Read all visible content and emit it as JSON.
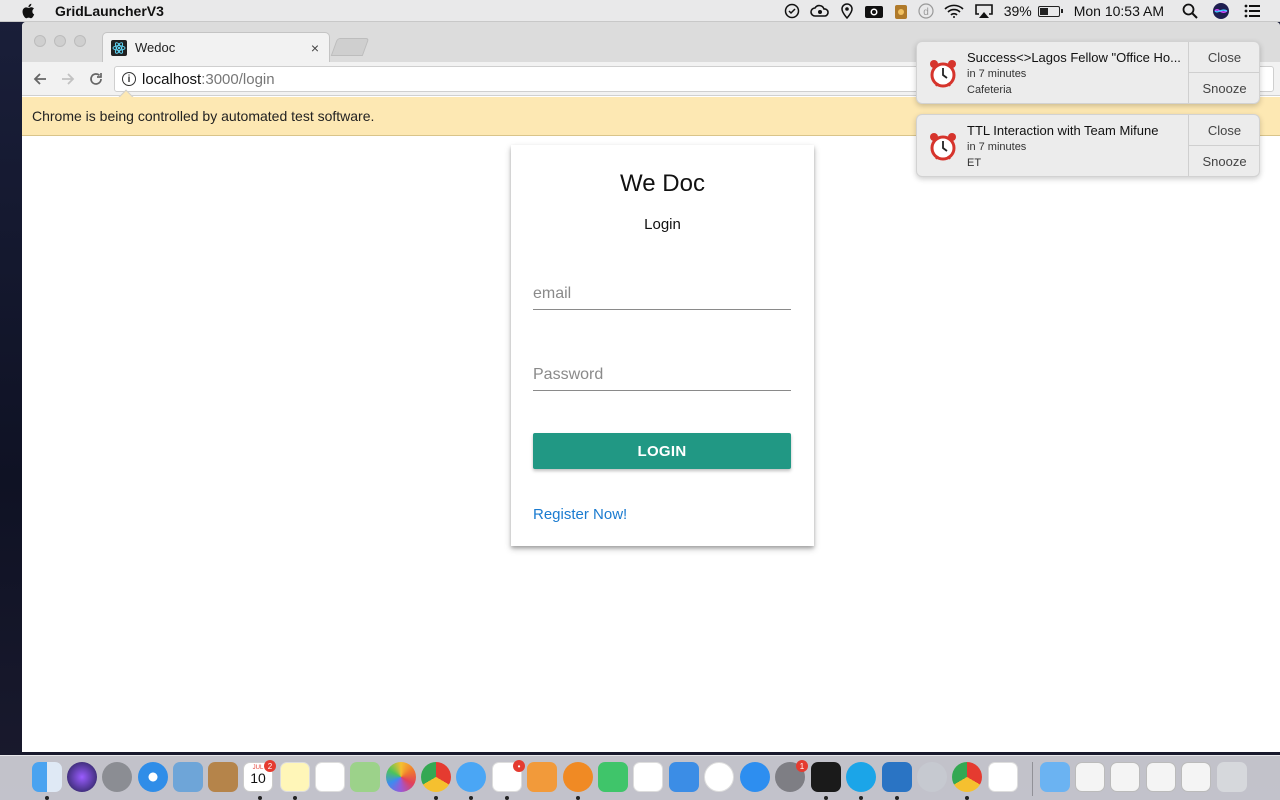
{
  "menubar": {
    "app_name": "GridLauncherV3",
    "battery": "39%",
    "battery_level": 0.39,
    "clock": "Mon 10:53 AM",
    "icons": [
      "dashlane-icon",
      "creative-cloud-icon",
      "location-icon",
      "camera-icon",
      "robot-icon",
      "d-icon",
      "wifi-icon",
      "airplay-icon",
      "battery-icon",
      "spotlight-search-icon",
      "siri-icon",
      "notification-center-icon"
    ]
  },
  "browser": {
    "tab_title": "Wedoc",
    "tab_close": "×",
    "url_host": "localhost",
    "url_path": ":3000/login",
    "infobar_text": "Chrome is being controlled by automated test software."
  },
  "login": {
    "app_title": "We Doc",
    "subtitle": "Login",
    "email_placeholder": "email",
    "password_placeholder": "Password",
    "button_label": "LOGIN",
    "register_link": "Register Now!",
    "accent_color": "#219884",
    "link_color": "#1a7bd0"
  },
  "notifications": [
    {
      "title": "Success<>Lagos Fellow \"Office Ho...",
      "time": "in 7 minutes",
      "location": "Cafeteria",
      "close": "Close",
      "snooze": "Snooze"
    },
    {
      "title": "TTL Interaction with Team Mifune",
      "time": "in 7 minutes",
      "location": "ET",
      "close": "Close",
      "snooze": "Snooze"
    }
  ],
  "dock": {
    "apps": [
      "finder",
      "siri",
      "launchpad",
      "safari",
      "mail",
      "contacts",
      "calendar",
      "notes",
      "reminders",
      "maps",
      "photos",
      "chrome",
      "messages",
      "slack",
      "pages",
      "books",
      "facetime",
      "numbers",
      "keynote",
      "itunes",
      "app-store",
      "system-preferences",
      "terminal",
      "skype",
      "vscode",
      "preferences-2",
      "chrome-2",
      "java"
    ],
    "calendar_day": "10",
    "calendar_month": "JUL",
    "calendar_badge": "2",
    "slack_badge": "•",
    "system_prefs_badge": "1"
  }
}
